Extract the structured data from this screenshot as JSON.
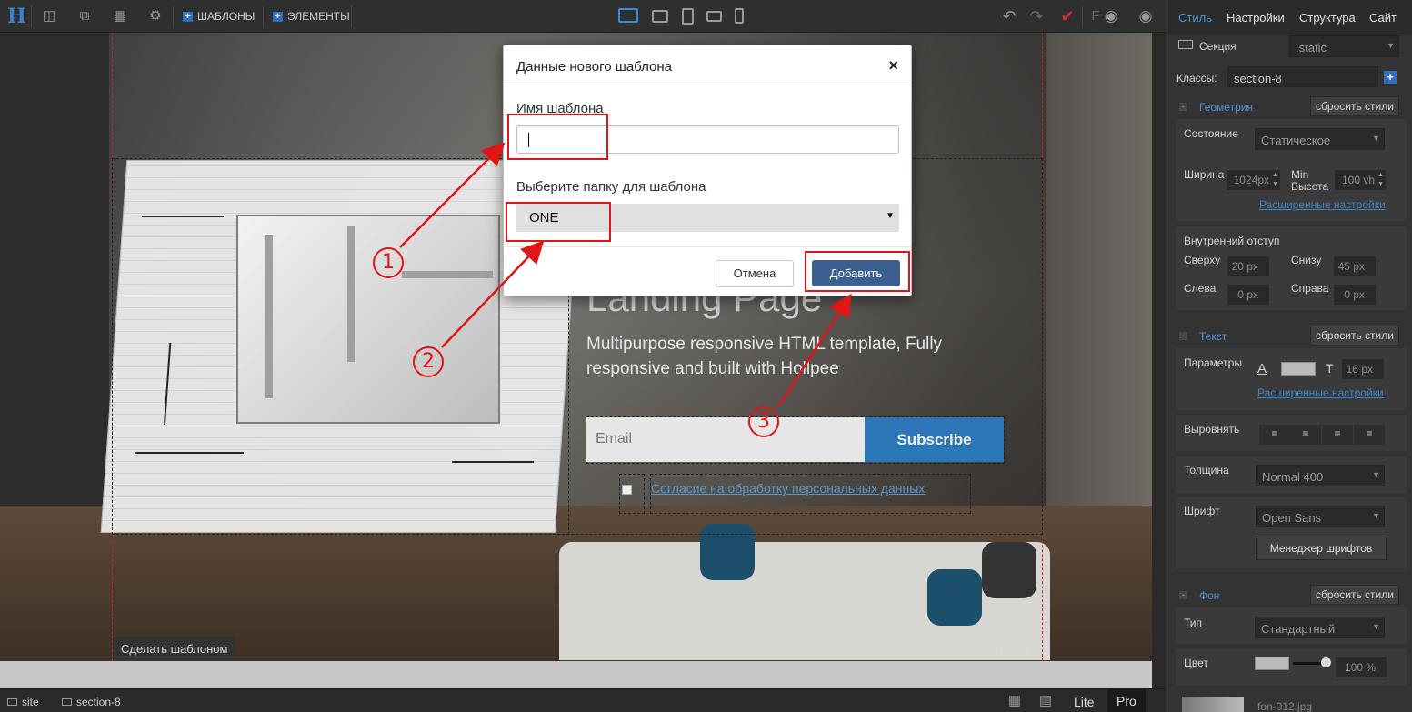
{
  "toolbar": {
    "logo": "H",
    "templates_label": "ШАБЛОНЫ",
    "elements_label": "ЭЛЕМЕНТЫ",
    "f_label": "F"
  },
  "canvas": {
    "hero_title": "Landing Page",
    "hero_subtitle": "Multipurpose responsive HTML template, Fully responsive and built with Hollpee",
    "email_placeholder": "Email",
    "subscribe_label": "Subscribe",
    "consent_link": "Согласие на обработку персональных данных",
    "make_template_label": "Сделать шаблоном"
  },
  "modal": {
    "title": "Данные нового шаблона",
    "close": "×",
    "name_label": "Имя шаблона",
    "name_value": "",
    "folder_label": "Выберите папку для шаблона",
    "folder_value": "ONE",
    "cancel_label": "Отмена",
    "add_label": "Добавить"
  },
  "annotations": {
    "n1": "1",
    "n2": "2",
    "n3": "3",
    "color": "#e01515"
  },
  "status": {
    "crumb_site": "site",
    "crumb_section": "section-8",
    "mode_lite": "Lite",
    "mode_pro": "Pro"
  },
  "panel": {
    "tabs": [
      "Стиль",
      "Настройки",
      "Структура",
      "Сайт"
    ],
    "element_label": "Секция",
    "state_select": ":static",
    "classes_label": "Классы:",
    "class_value": "section-8",
    "geometry": {
      "title": "Геометрия",
      "reset": "сбросить стили",
      "state_label": "Состояние",
      "state_value": "Статическое",
      "width_label": "Ширина",
      "width_value": "1024px",
      "min_label": "Min",
      "height_label": "Высота",
      "height_value": "100 vh",
      "advanced": "Расширенные настройки",
      "padding_label": "Внутренний отступ",
      "top_label": "Сверху",
      "top_value": "20",
      "bottom_label": "Снизу",
      "bottom_value": "45",
      "left_label": "Слева",
      "left_value": "0",
      "right_label": "Справа",
      "right_value": "0",
      "unit": "px"
    },
    "text": {
      "title": "Текст",
      "reset": "сбросить стили",
      "params_label": "Параметры",
      "font_size": "16",
      "unit": "px",
      "advanced": "Расширенные настройки",
      "align_label": "Выровнять",
      "weight_label": "Толщина",
      "weight_value": "Normal 400",
      "font_label": "Шрифт",
      "font_value": "Open Sans",
      "font_manager": "Менеджер шрифтов"
    },
    "bg": {
      "title": "Фон",
      "reset": "сбросить стили",
      "type_label": "Тип",
      "type_value": "Стандартный",
      "color_label": "Цвет",
      "opacity_value": "100 %",
      "file_name": "fon-012.jpg"
    }
  },
  "colors": {
    "accent": "#4a94d8",
    "subscribe": "#2d77b8",
    "add_button": "#3a5f90"
  }
}
